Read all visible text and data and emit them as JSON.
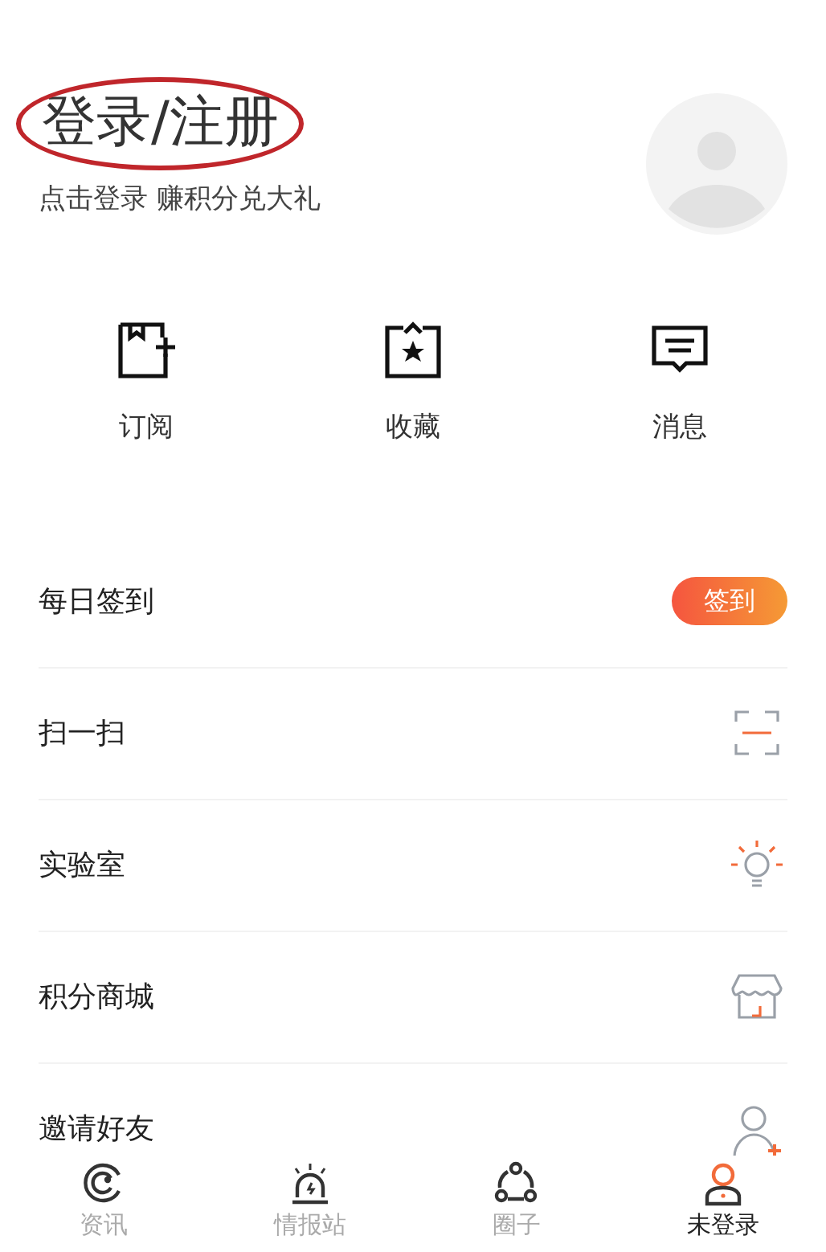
{
  "header": {
    "title": "登录/注册",
    "subtitle": "点击登录 赚积分兑大礼",
    "annotation": {
      "kind": "ellipse",
      "color": "#c0262b"
    }
  },
  "shortcuts": [
    {
      "kind": "subscribe",
      "label": "订阅"
    },
    {
      "kind": "favorite",
      "label": "收藏"
    },
    {
      "kind": "message",
      "label": "消息"
    }
  ],
  "menu": [
    {
      "kind": "button",
      "label": "每日签到",
      "button": "签到"
    },
    {
      "kind": "scan",
      "label": "扫一扫"
    },
    {
      "kind": "lab",
      "label": "实验室"
    },
    {
      "kind": "shop",
      "label": "积分商城"
    },
    {
      "kind": "invite",
      "label": "邀请好友"
    }
  ],
  "tabs": [
    {
      "kind": "news",
      "label": "资讯",
      "selected": false
    },
    {
      "kind": "alarm",
      "label": "情报站",
      "selected": false
    },
    {
      "kind": "circle",
      "label": "圈子",
      "selected": false
    },
    {
      "kind": "user",
      "label": "未登录",
      "selected": true
    }
  ]
}
